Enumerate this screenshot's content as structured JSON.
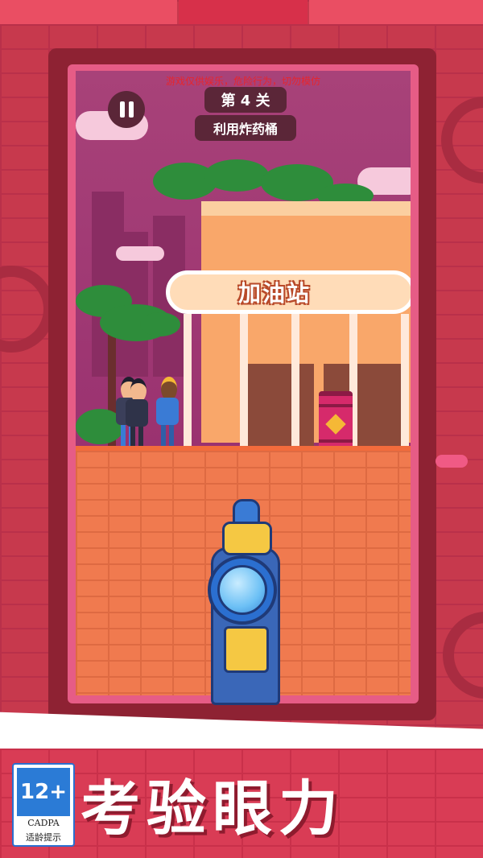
{
  "hud": {
    "warning": "游戏仅供娱乐，危险行为，切勿模仿",
    "level": "第 4 关",
    "hint": "利用炸药桶",
    "pause_icon": "pause-icon"
  },
  "scene": {
    "station_sign": "加油站"
  },
  "banner": {
    "slogan": "考验眼力"
  },
  "age_rating": {
    "age": "12+",
    "org": "CADPA",
    "label": "适龄提示"
  },
  "colors": {
    "background": "#c63a4d",
    "frame": "#8e2233",
    "hud_pill": "#5b2638",
    "warning_text": "#e8252d",
    "gun_blue": "#3a67b8",
    "gun_yellow": "#f5c843",
    "barrel": "#d62a6b"
  }
}
